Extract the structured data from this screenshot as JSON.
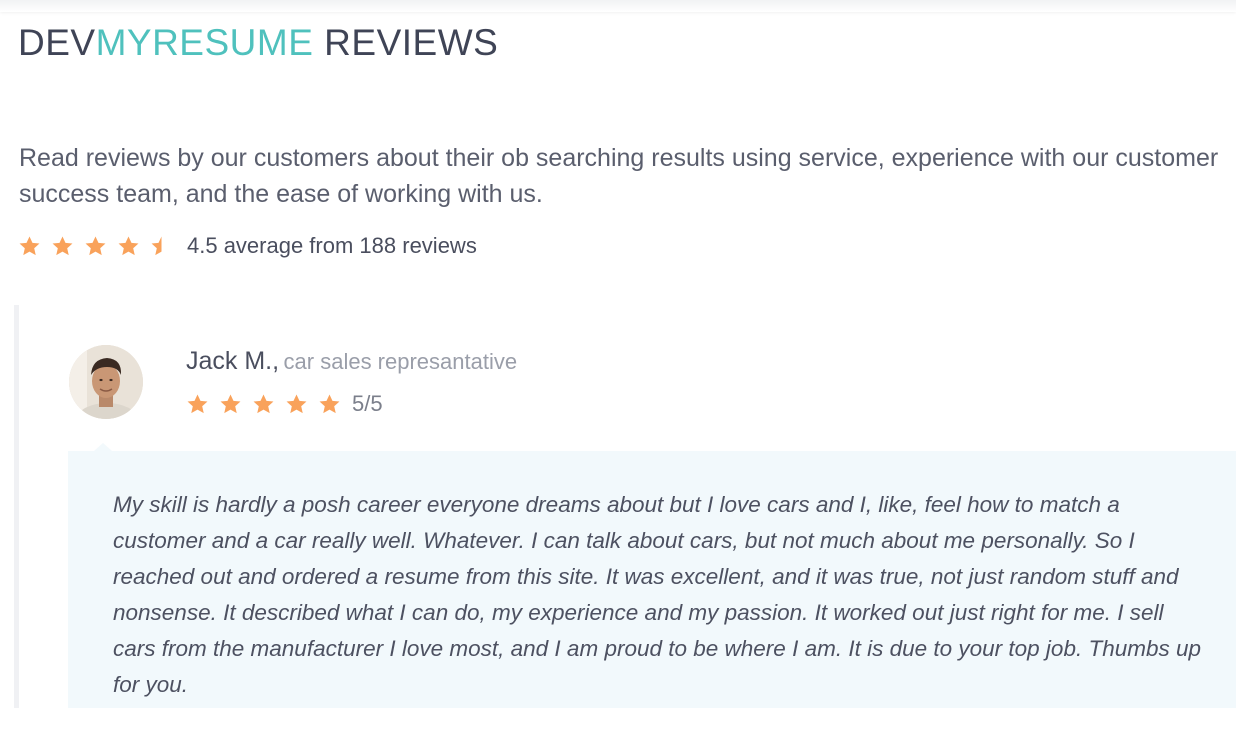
{
  "header": {
    "title_part1": "DEV",
    "title_part2": "MYRESUME",
    "title_part3": " REVIEWS"
  },
  "intro": {
    "text": "Read reviews by our customers about their ob searching results using service, experience with our customer success team, and the ease of working with us."
  },
  "summary": {
    "rating": 4.5,
    "max_rating": 5,
    "text": "4.5 average from 188 reviews"
  },
  "review": {
    "name": "Jack M.,",
    "role": "car sales represantative",
    "rating": 5,
    "score_text": "5/5",
    "body": "My skill is hardly a posh career everyone dreams about but I love cars and I, like, feel how to match a customer and a car really well. Whatever. I can talk about cars, but not much about me personally. So I reached out and ordered a resume from this site. It was excellent, and it was true, not just random stuff and nonsense. It described what I can do, my experience and my passion. It worked out just right for me. I sell cars from the manufacturer I love most, and I am proud to be where I am. It is due to your top job. Thumbs up for you."
  },
  "colors": {
    "accent": "#4fc1bd",
    "star": "#f9a25b",
    "review_bg": "#f2f9fc"
  },
  "icons": {
    "star": "star-icon",
    "half_star": "half-star-icon",
    "avatar": "reviewer-photo"
  }
}
